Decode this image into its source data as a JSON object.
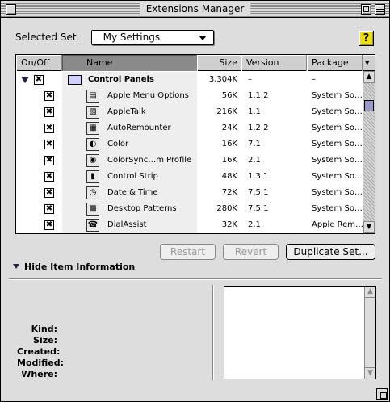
{
  "window": {
    "title": "Extensions Manager"
  },
  "selected_set": {
    "label": "Selected Set:",
    "value": "My Settings"
  },
  "help_label": "?",
  "columns": {
    "onoff": "On/Off",
    "name": "Name",
    "size": "Size",
    "version": "Version",
    "package": "Package"
  },
  "group": {
    "name": "Control Panels",
    "size": "3,304K",
    "version": "–",
    "package": "–",
    "checked": "✖"
  },
  "rows": [
    {
      "name": "Apple Menu Options",
      "size": "56K",
      "version": "1.1.2",
      "package": "System So…",
      "check": "✖",
      "icon": "▤"
    },
    {
      "name": "AppleTalk",
      "size": "216K",
      "version": "1.1",
      "package": "System So…",
      "check": "✖",
      "icon": "▧"
    },
    {
      "name": "AutoRemounter",
      "size": "24K",
      "version": "1.2.2",
      "package": "System So…",
      "check": "✖",
      "icon": "▦"
    },
    {
      "name": "Color",
      "size": "16K",
      "version": "7.1",
      "package": "System So…",
      "check": "✖",
      "icon": "◐"
    },
    {
      "name": "ColorSync…m Profile",
      "size": "16K",
      "version": "2.1",
      "package": "System So…",
      "check": "✖",
      "icon": "◉"
    },
    {
      "name": "Control Strip",
      "size": "48K",
      "version": "1.3.1",
      "package": "System So…",
      "check": "✖",
      "icon": "▮"
    },
    {
      "name": "Date & Time",
      "size": "72K",
      "version": "7.5.1",
      "package": "System So…",
      "check": "✖",
      "icon": "◷"
    },
    {
      "name": "Desktop Patterns",
      "size": "280K",
      "version": "7.5.1",
      "package": "System So…",
      "check": "✖",
      "icon": "▩"
    },
    {
      "name": "DialAssist",
      "size": "32K",
      "version": "2.1",
      "package": "Apple Rem…",
      "check": "✖",
      "icon": "☎"
    }
  ],
  "buttons": {
    "restart": "Restart",
    "revert": "Revert",
    "duplicate": "Duplicate Set..."
  },
  "hide_info": "Hide Item Information",
  "info_labels": {
    "kind": "Kind:",
    "size": "Size:",
    "created": "Created:",
    "modified": "Modified:",
    "where": "Where:"
  },
  "scroll_up": "▲",
  "scroll_down": "▼",
  "list_menu": "▾"
}
